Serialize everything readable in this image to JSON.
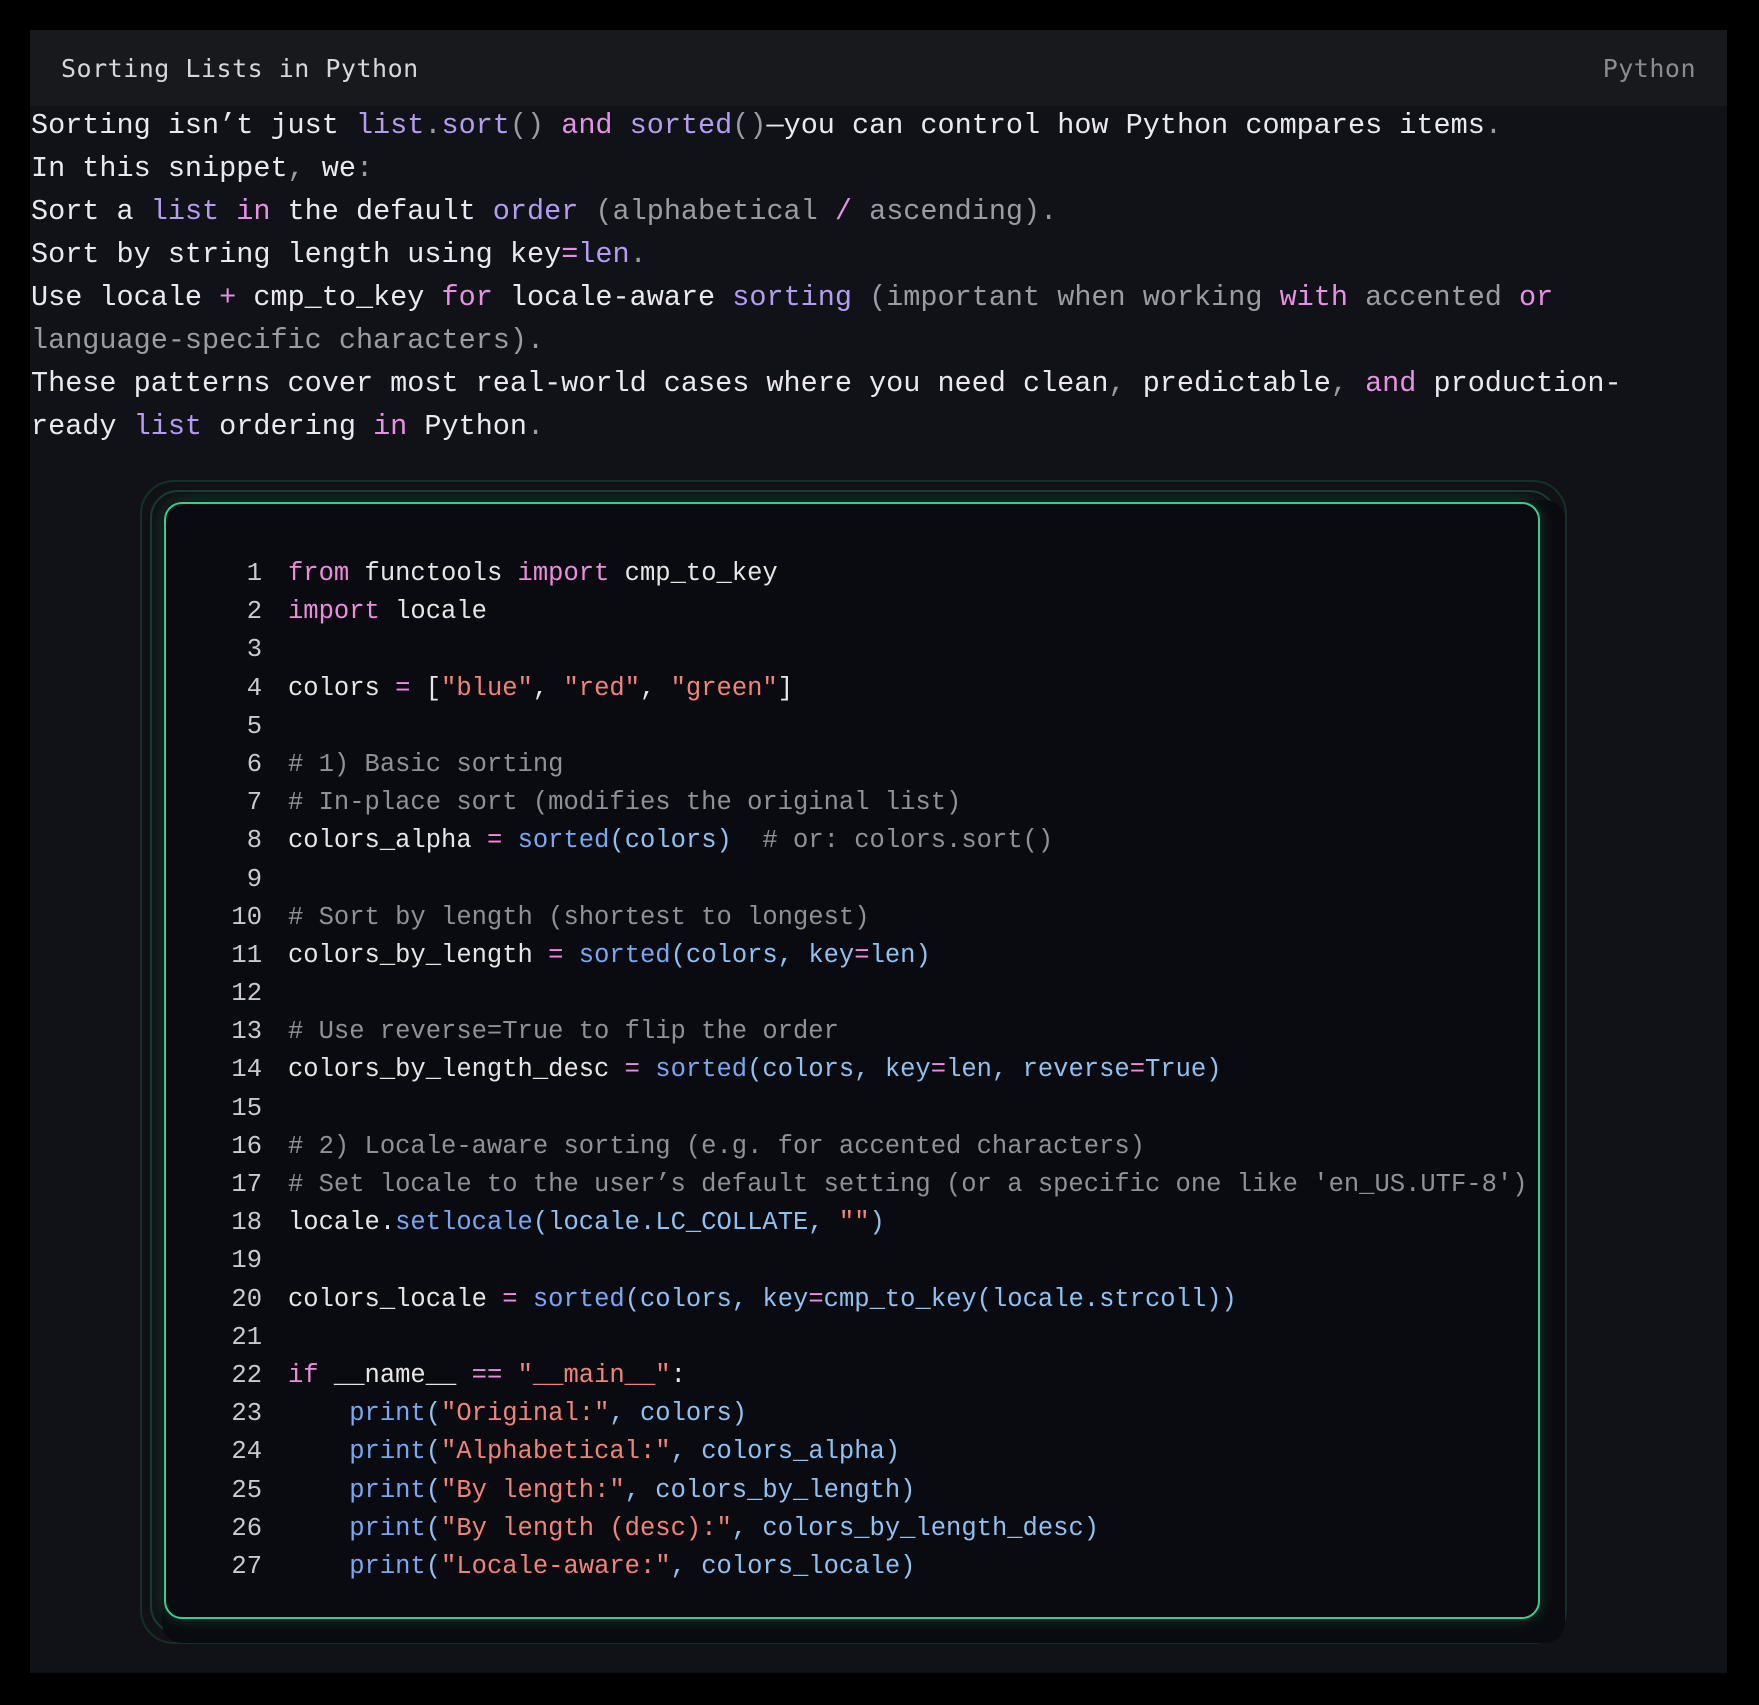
{
  "card": {
    "title": "Sorting Lists in Python",
    "language": "Python"
  },
  "intro": {
    "p1": [
      {
        "t": "Sorting isn’t just ",
        "c": ""
      },
      {
        "t": "list",
        "c": "fn"
      },
      {
        "t": ".",
        "c": "pun"
      },
      {
        "t": "sort",
        "c": "fn"
      },
      {
        "t": "() ",
        "c": "pun"
      },
      {
        "t": "and ",
        "c": "kw"
      },
      {
        "t": "sorted",
        "c": "fn"
      },
      {
        "t": "()",
        "c": "pun"
      },
      {
        "t": "—you can control how Python compares items",
        "c": ""
      },
      {
        "t": ".",
        "c": "pun"
      }
    ],
    "p2": [
      {
        "t": "In this snippet",
        "c": ""
      },
      {
        "t": ", ",
        "c": "pun"
      },
      {
        "t": "we",
        "c": ""
      },
      {
        "t": ":",
        "c": "pun"
      }
    ],
    "p3": [
      {
        "t": "Sort a ",
        "c": ""
      },
      {
        "t": "list ",
        "c": "fn"
      },
      {
        "t": "in ",
        "c": "kw"
      },
      {
        "t": "the default ",
        "c": ""
      },
      {
        "t": "order ",
        "c": "fn"
      },
      {
        "t": "(alphabetical ",
        "c": "dim"
      },
      {
        "t": "/ ",
        "c": "kw"
      },
      {
        "t": "ascending).",
        "c": "dim"
      }
    ],
    "p4": [
      {
        "t": "Sort by string length using key",
        "c": ""
      },
      {
        "t": "=",
        "c": "kw"
      },
      {
        "t": "len",
        "c": "fn"
      },
      {
        "t": ".",
        "c": "pun"
      }
    ],
    "p5": [
      {
        "t": "Use locale ",
        "c": ""
      },
      {
        "t": "+ ",
        "c": "kw"
      },
      {
        "t": "cmp_to_key ",
        "c": ""
      },
      {
        "t": "for ",
        "c": "kw"
      },
      {
        "t": "locale-aware ",
        "c": ""
      },
      {
        "t": "sorting ",
        "c": "fn"
      },
      {
        "t": "(important when working ",
        "c": "dim"
      },
      {
        "t": "with ",
        "c": "kw"
      },
      {
        "t": "accented ",
        "c": "dim"
      },
      {
        "t": "or",
        "c": "kw"
      },
      {
        "t": "\nlanguage-specific characters).",
        "c": "dim"
      }
    ],
    "p6": [
      {
        "t": "These patterns cover most real-world cases where you need clean",
        "c": ""
      },
      {
        "t": ", ",
        "c": "pun"
      },
      {
        "t": "predictable",
        "c": ""
      },
      {
        "t": ", ",
        "c": "pun"
      },
      {
        "t": "and ",
        "c": "kw"
      },
      {
        "t": "production-\nready ",
        "c": ""
      },
      {
        "t": "list ",
        "c": "fn"
      },
      {
        "t": "ordering ",
        "c": ""
      },
      {
        "t": "in ",
        "c": "kw"
      },
      {
        "t": "Python",
        "c": ""
      },
      {
        "t": ".",
        "c": "pun"
      }
    ]
  },
  "code": {
    "lines": [
      [
        {
          "t": "from",
          "c": "kw"
        },
        {
          "t": " functools ",
          "c": "id"
        },
        {
          "t": "import",
          "c": "kw"
        },
        {
          "t": " cmp_to_key",
          "c": "id"
        }
      ],
      [
        {
          "t": "import",
          "c": "kw"
        },
        {
          "t": " locale",
          "c": "id"
        }
      ],
      [],
      [
        {
          "t": "colors ",
          "c": "id"
        },
        {
          "t": "=",
          "c": "op"
        },
        {
          "t": " [",
          "c": "id"
        },
        {
          "t": "\"blue\"",
          "c": "str"
        },
        {
          "t": ", ",
          "c": "id"
        },
        {
          "t": "\"red\"",
          "c": "str"
        },
        {
          "t": ", ",
          "c": "id"
        },
        {
          "t": "\"green\"",
          "c": "str"
        },
        {
          "t": "]",
          "c": "id"
        }
      ],
      [],
      [
        {
          "t": "# 1) Basic sorting",
          "c": "cm"
        }
      ],
      [
        {
          "t": "# In-place sort (modifies the original list)",
          "c": "cm"
        }
      ],
      [
        {
          "t": "colors_alpha ",
          "c": "id"
        },
        {
          "t": "=",
          "c": "op"
        },
        {
          "t": " ",
          "c": "id"
        },
        {
          "t": "sorted",
          "c": "fn"
        },
        {
          "t": "(colors)",
          "c": "arg"
        },
        {
          "t": "  # or: colors.sort()",
          "c": "cm"
        }
      ],
      [],
      [
        {
          "t": "# Sort by length (shortest to longest)",
          "c": "cm"
        }
      ],
      [
        {
          "t": "colors_by_length ",
          "c": "id"
        },
        {
          "t": "=",
          "c": "op"
        },
        {
          "t": " ",
          "c": "id"
        },
        {
          "t": "sorted",
          "c": "fn"
        },
        {
          "t": "(colors, key",
          "c": "arg"
        },
        {
          "t": "=",
          "c": "op"
        },
        {
          "t": "len)",
          "c": "arg"
        }
      ],
      [],
      [
        {
          "t": "# Use reverse=True to flip the order",
          "c": "cm"
        }
      ],
      [
        {
          "t": "colors_by_length_desc ",
          "c": "id"
        },
        {
          "t": "=",
          "c": "op"
        },
        {
          "t": " ",
          "c": "id"
        },
        {
          "t": "sorted",
          "c": "fn"
        },
        {
          "t": "(colors, key",
          "c": "arg"
        },
        {
          "t": "=",
          "c": "op"
        },
        {
          "t": "len, reverse",
          "c": "arg"
        },
        {
          "t": "=",
          "c": "op"
        },
        {
          "t": "True)",
          "c": "arg"
        }
      ],
      [],
      [
        {
          "t": "# 2) Locale-aware sorting (e.g. for accented characters)",
          "c": "cm"
        }
      ],
      [
        {
          "t": "# Set locale to the user’s default setting (or a specific one like 'en_US.UTF-8')",
          "c": "cm"
        }
      ],
      [
        {
          "t": "locale.",
          "c": "id"
        },
        {
          "t": "setlocale",
          "c": "fn"
        },
        {
          "t": "(locale.LC_COLLATE, ",
          "c": "arg"
        },
        {
          "t": "\"\"",
          "c": "str"
        },
        {
          "t": ")",
          "c": "arg"
        }
      ],
      [],
      [
        {
          "t": "colors_locale ",
          "c": "id"
        },
        {
          "t": "=",
          "c": "op"
        },
        {
          "t": " ",
          "c": "id"
        },
        {
          "t": "sorted",
          "c": "fn"
        },
        {
          "t": "(colors, key",
          "c": "arg"
        },
        {
          "t": "=",
          "c": "op"
        },
        {
          "t": "cmp_to_key(locale.strcoll))",
          "c": "arg"
        }
      ],
      [],
      [
        {
          "t": "if",
          "c": "kw"
        },
        {
          "t": " __name__ ",
          "c": "id"
        },
        {
          "t": "==",
          "c": "op"
        },
        {
          "t": " ",
          "c": "id"
        },
        {
          "t": "\"__main__\"",
          "c": "str"
        },
        {
          "t": ":",
          "c": "id"
        }
      ],
      [
        {
          "t": "    ",
          "c": "id"
        },
        {
          "t": "print",
          "c": "fn"
        },
        {
          "t": "(",
          "c": "arg"
        },
        {
          "t": "\"Original:\"",
          "c": "str"
        },
        {
          "t": ", colors)",
          "c": "arg"
        }
      ],
      [
        {
          "t": "    ",
          "c": "id"
        },
        {
          "t": "print",
          "c": "fn"
        },
        {
          "t": "(",
          "c": "arg"
        },
        {
          "t": "\"Alphabetical:\"",
          "c": "str"
        },
        {
          "t": ", colors_alpha)",
          "c": "arg"
        }
      ],
      [
        {
          "t": "    ",
          "c": "id"
        },
        {
          "t": "print",
          "c": "fn"
        },
        {
          "t": "(",
          "c": "arg"
        },
        {
          "t": "\"By length:\"",
          "c": "str"
        },
        {
          "t": ", colors_by_length)",
          "c": "arg"
        }
      ],
      [
        {
          "t": "    ",
          "c": "id"
        },
        {
          "t": "print",
          "c": "fn"
        },
        {
          "t": "(",
          "c": "arg"
        },
        {
          "t": "\"By length (desc):\"",
          "c": "str"
        },
        {
          "t": ", colors_by_length_desc)",
          "c": "arg"
        }
      ],
      [
        {
          "t": "    ",
          "c": "id"
        },
        {
          "t": "print",
          "c": "fn"
        },
        {
          "t": "(",
          "c": "arg"
        },
        {
          "t": "\"Locale-aware:\"",
          "c": "str"
        },
        {
          "t": ", colors_locale)",
          "c": "arg"
        }
      ]
    ]
  },
  "colors": {
    "accent_border": "#35d090",
    "keyword": "#f08be0",
    "string": "#f2837a",
    "function": "#7aa7f5",
    "comment": "#8f909a"
  }
}
